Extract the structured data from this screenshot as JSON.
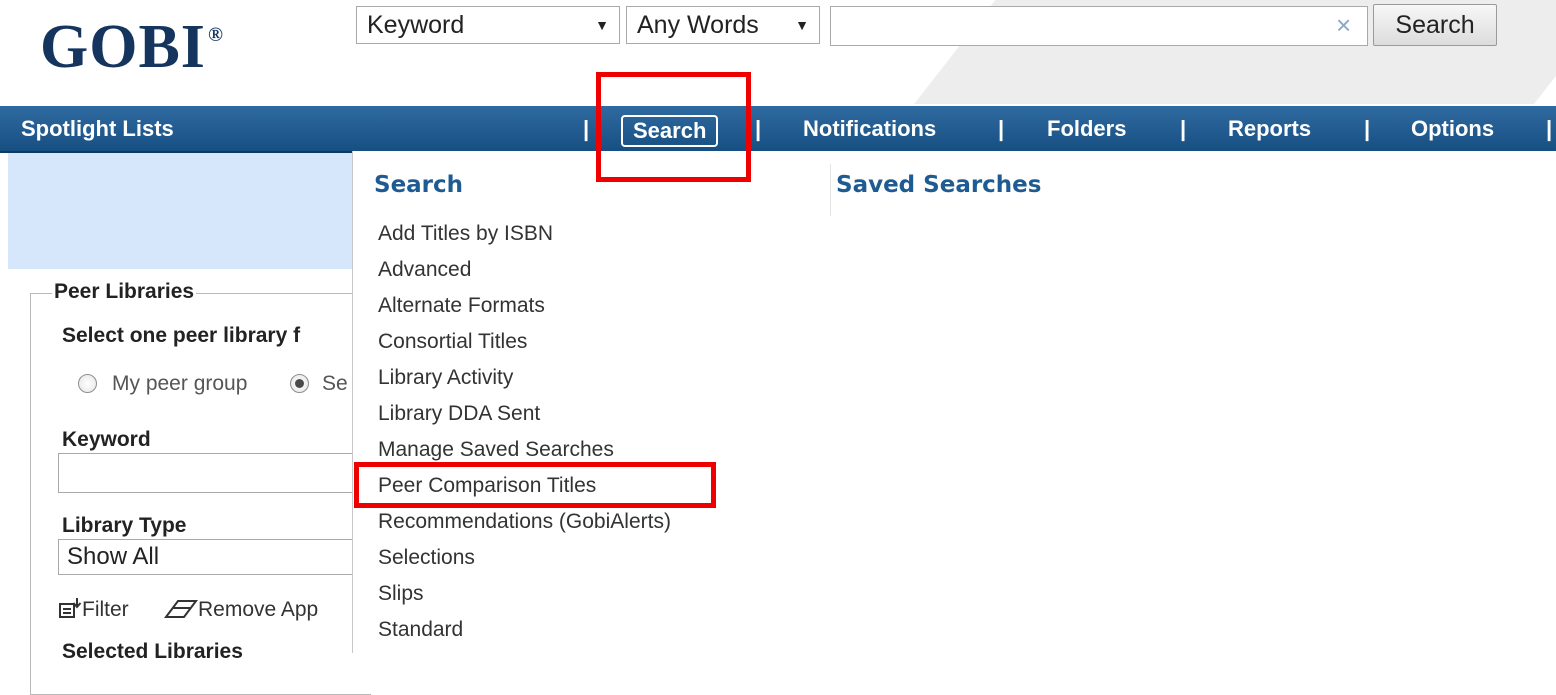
{
  "logo": {
    "text": "GOBI",
    "mark": "®"
  },
  "searchbar": {
    "field_select": "Keyword",
    "match_select": "Any Words",
    "query_value": "",
    "clear_icon": "×",
    "button": "Search"
  },
  "nav": {
    "items": [
      "Spotlight Lists",
      "Search",
      "Notifications",
      "Folders",
      "Reports",
      "Options"
    ],
    "separator": "|"
  },
  "dropdown": {
    "col1_title": "Search",
    "col2_title": "Saved Searches",
    "items": [
      "Add Titles by ISBN",
      "Advanced",
      "Alternate Formats",
      "Consortial Titles",
      "Library Activity",
      "Library DDA Sent",
      "Manage Saved Searches",
      "Peer Comparison Titles",
      "Recommendations (GobiAlerts)",
      "Selections",
      "Slips",
      "Standard"
    ]
  },
  "panel": {
    "legend": "Peer Libraries",
    "instruction": "Select one peer library f",
    "radio_my_peer": "My peer group",
    "radio_select": "Se",
    "keyword_label": "Keyword",
    "keyword_value": "",
    "library_type_label": "Library Type",
    "library_type_value": "Show All",
    "filter_label": "Filter",
    "remove_label": "Remove App",
    "selected_label": "Selected Libraries"
  },
  "colors": {
    "nav_bg": "#1e5a8e",
    "heading_blue": "#1f5b93",
    "annotation_red": "#ee0000",
    "banner_blue": "#d6e7fb"
  }
}
